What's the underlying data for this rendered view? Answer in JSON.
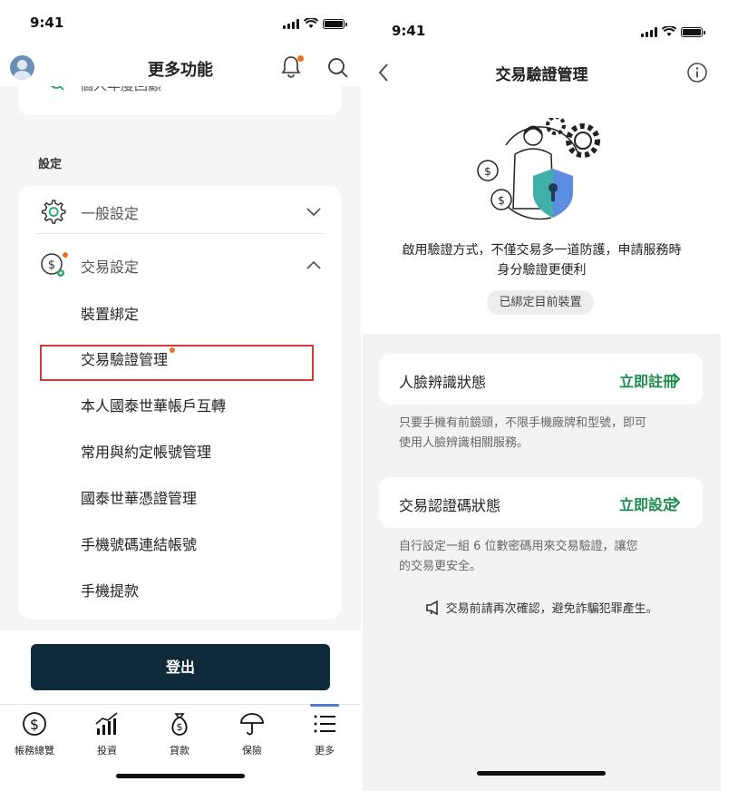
{
  "left_screen": {
    "status": {
      "time": "9:41"
    },
    "header": {
      "title": "更多功能"
    },
    "partial_item_label": "個人年度回顧",
    "section_label": "設定",
    "settings": {
      "general_label": "一般設定",
      "trade_label": "交易設定",
      "trade_sub_items": [
        "裝置綁定",
        "交易驗證管理",
        "本人國泰世華帳戶互轉",
        "常用與約定帳號管理",
        "國泰世華憑證管理",
        "手機號碼連結帳號",
        "手機提款"
      ]
    },
    "logout_label": "登出",
    "tabs": [
      {
        "label": "帳務總覽",
        "icon": "dollar-circle-icon"
      },
      {
        "label": "投資",
        "icon": "chart-up-icon"
      },
      {
        "label": "貸款",
        "icon": "money-bag-icon"
      },
      {
        "label": "保險",
        "icon": "umbrella-icon"
      },
      {
        "label": "更多",
        "icon": "menu-list-icon"
      }
    ],
    "colors": {
      "accent_dark": "#0f2b3b",
      "notify_dot": "#e8721e",
      "highlight_border": "#d43b3b",
      "active_tab": "#4a7fd1"
    }
  },
  "right_screen": {
    "status": {
      "time": "9:41"
    },
    "header": {
      "title": "交易驗證管理"
    },
    "description_line1": "啟用驗證方式，不僅交易多一道防護，申請服務時",
    "description_line2": "身分驗證更便利",
    "bound_badge": "已綁定目前裝置",
    "face_id": {
      "label": "人臉辨識狀態",
      "action": "立即註冊",
      "note_line1": "只要手機有前鏡頭，不限手機廠牌和型號，即可",
      "note_line2": "使用人臉辨識相關服務。"
    },
    "trade_pin": {
      "label": "交易認證碼狀態",
      "action": "立即設定",
      "note_line1": "自行設定一組 6 位數密碼用來交易驗證，讓您",
      "note_line2": "的交易更安全。"
    },
    "warning": "交易前請再次確認，避免詐騙犯罪產生。",
    "colors": {
      "action_green": "#1a8c4c",
      "shield_teal": "#3fb0a8",
      "shield_blue": "#5b8ee0"
    }
  }
}
